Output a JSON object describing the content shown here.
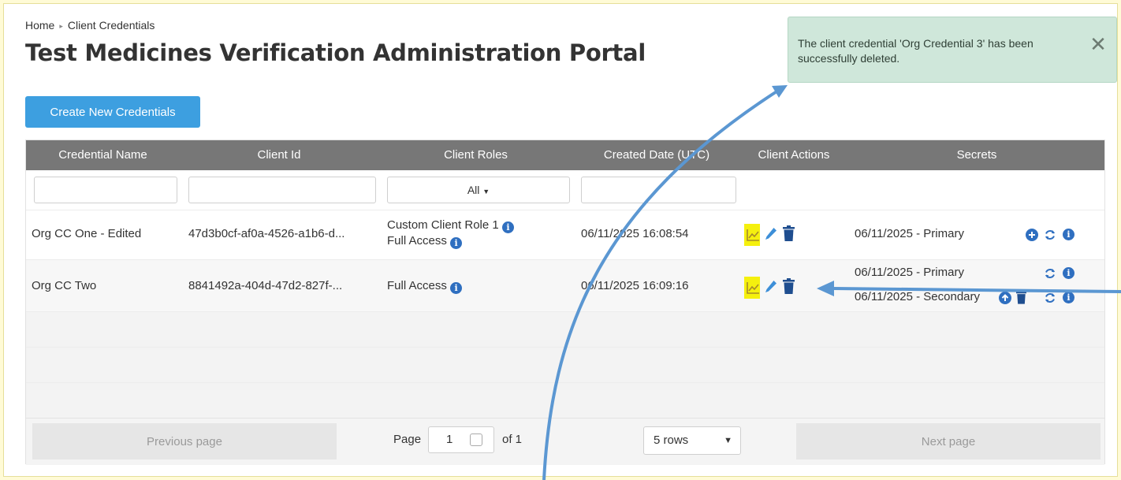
{
  "breadcrumb": {
    "home": "Home",
    "current": "Client Credentials"
  },
  "page_title": "Test Medicines Verification Administration Portal",
  "create_button": "Create New Credentials",
  "toast": {
    "message": "The client credential 'Org Credential 3' has been successfully deleted.",
    "close_symbol": "✕"
  },
  "table": {
    "headers": [
      "Credential Name",
      "Client Id",
      "Client Roles",
      "Created Date (UTC)",
      "Client Actions",
      "Secrets"
    ],
    "roles_filter": "All",
    "rows": [
      {
        "name": "Org CC One - Edited",
        "client_id": "47d3b0cf-af0a-4526-a1b6-d...",
        "roles": [
          "Custom Client Role 1",
          "Full Access"
        ],
        "created": "06/11/2025 16:08:54",
        "secrets": [
          "06/11/2025 - Primary"
        ]
      },
      {
        "name": "Org CC Two",
        "client_id": "8841492a-404d-47d2-827f-...",
        "roles": [
          "Full Access"
        ],
        "created": "06/11/2025 16:09:16",
        "secrets": [
          "06/11/2025 - Primary",
          "06/11/2025 - Secondary"
        ]
      }
    ]
  },
  "pagination": {
    "previous": "Previous page",
    "page_label": "Page",
    "page_value": "1",
    "of_label": "of 1",
    "rows_option": "5 rows",
    "next": "Next page"
  },
  "colors": {
    "accent_blue": "#3d9fe0",
    "icon_blue": "#2f6fc0",
    "highlight_yellow": "#f5f00e",
    "toast_green": "#cfe7da",
    "header_gray": "#777777",
    "annotation_arrow": "#5b97d2"
  },
  "icons": {
    "stats": "chart-line-icon",
    "edit": "pencil-icon",
    "delete": "trash-icon",
    "add_secret": "plus-circle-icon",
    "rotate_secret": "refresh-icon",
    "info": "info-icon",
    "promote_secret": "arrow-up-circle-icon"
  }
}
